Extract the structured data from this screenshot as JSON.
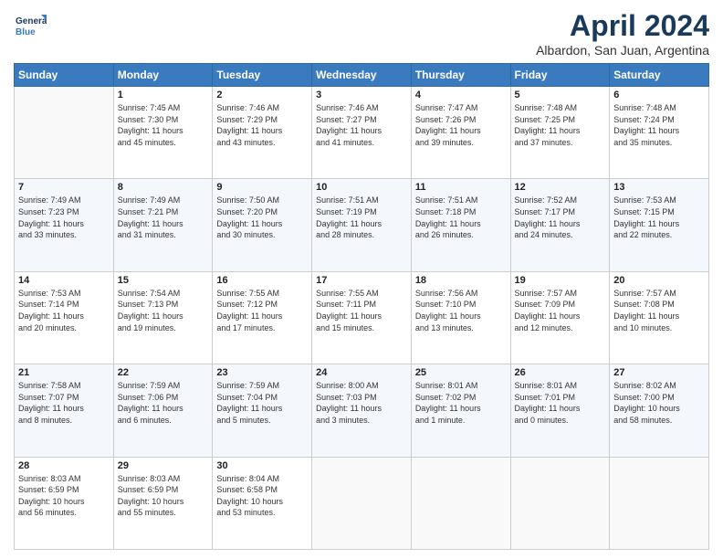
{
  "logo": {
    "line1": "General",
    "line2": "Blue"
  },
  "title": "April 2024",
  "subtitle": "Albardon, San Juan, Argentina",
  "days_header": [
    "Sunday",
    "Monday",
    "Tuesday",
    "Wednesday",
    "Thursday",
    "Friday",
    "Saturday"
  ],
  "weeks": [
    [
      {
        "num": "",
        "info": ""
      },
      {
        "num": "1",
        "info": "Sunrise: 7:45 AM\nSunset: 7:30 PM\nDaylight: 11 hours\nand 45 minutes."
      },
      {
        "num": "2",
        "info": "Sunrise: 7:46 AM\nSunset: 7:29 PM\nDaylight: 11 hours\nand 43 minutes."
      },
      {
        "num": "3",
        "info": "Sunrise: 7:46 AM\nSunset: 7:27 PM\nDaylight: 11 hours\nand 41 minutes."
      },
      {
        "num": "4",
        "info": "Sunrise: 7:47 AM\nSunset: 7:26 PM\nDaylight: 11 hours\nand 39 minutes."
      },
      {
        "num": "5",
        "info": "Sunrise: 7:48 AM\nSunset: 7:25 PM\nDaylight: 11 hours\nand 37 minutes."
      },
      {
        "num": "6",
        "info": "Sunrise: 7:48 AM\nSunset: 7:24 PM\nDaylight: 11 hours\nand 35 minutes."
      }
    ],
    [
      {
        "num": "7",
        "info": "Sunrise: 7:49 AM\nSunset: 7:23 PM\nDaylight: 11 hours\nand 33 minutes."
      },
      {
        "num": "8",
        "info": "Sunrise: 7:49 AM\nSunset: 7:21 PM\nDaylight: 11 hours\nand 31 minutes."
      },
      {
        "num": "9",
        "info": "Sunrise: 7:50 AM\nSunset: 7:20 PM\nDaylight: 11 hours\nand 30 minutes."
      },
      {
        "num": "10",
        "info": "Sunrise: 7:51 AM\nSunset: 7:19 PM\nDaylight: 11 hours\nand 28 minutes."
      },
      {
        "num": "11",
        "info": "Sunrise: 7:51 AM\nSunset: 7:18 PM\nDaylight: 11 hours\nand 26 minutes."
      },
      {
        "num": "12",
        "info": "Sunrise: 7:52 AM\nSunset: 7:17 PM\nDaylight: 11 hours\nand 24 minutes."
      },
      {
        "num": "13",
        "info": "Sunrise: 7:53 AM\nSunset: 7:15 PM\nDaylight: 11 hours\nand 22 minutes."
      }
    ],
    [
      {
        "num": "14",
        "info": "Sunrise: 7:53 AM\nSunset: 7:14 PM\nDaylight: 11 hours\nand 20 minutes."
      },
      {
        "num": "15",
        "info": "Sunrise: 7:54 AM\nSunset: 7:13 PM\nDaylight: 11 hours\nand 19 minutes."
      },
      {
        "num": "16",
        "info": "Sunrise: 7:55 AM\nSunset: 7:12 PM\nDaylight: 11 hours\nand 17 minutes."
      },
      {
        "num": "17",
        "info": "Sunrise: 7:55 AM\nSunset: 7:11 PM\nDaylight: 11 hours\nand 15 minutes."
      },
      {
        "num": "18",
        "info": "Sunrise: 7:56 AM\nSunset: 7:10 PM\nDaylight: 11 hours\nand 13 minutes."
      },
      {
        "num": "19",
        "info": "Sunrise: 7:57 AM\nSunset: 7:09 PM\nDaylight: 11 hours\nand 12 minutes."
      },
      {
        "num": "20",
        "info": "Sunrise: 7:57 AM\nSunset: 7:08 PM\nDaylight: 11 hours\nand 10 minutes."
      }
    ],
    [
      {
        "num": "21",
        "info": "Sunrise: 7:58 AM\nSunset: 7:07 PM\nDaylight: 11 hours\nand 8 minutes."
      },
      {
        "num": "22",
        "info": "Sunrise: 7:59 AM\nSunset: 7:06 PM\nDaylight: 11 hours\nand 6 minutes."
      },
      {
        "num": "23",
        "info": "Sunrise: 7:59 AM\nSunset: 7:04 PM\nDaylight: 11 hours\nand 5 minutes."
      },
      {
        "num": "24",
        "info": "Sunrise: 8:00 AM\nSunset: 7:03 PM\nDaylight: 11 hours\nand 3 minutes."
      },
      {
        "num": "25",
        "info": "Sunrise: 8:01 AM\nSunset: 7:02 PM\nDaylight: 11 hours\nand 1 minute."
      },
      {
        "num": "26",
        "info": "Sunrise: 8:01 AM\nSunset: 7:01 PM\nDaylight: 11 hours\nand 0 minutes."
      },
      {
        "num": "27",
        "info": "Sunrise: 8:02 AM\nSunset: 7:00 PM\nDaylight: 10 hours\nand 58 minutes."
      }
    ],
    [
      {
        "num": "28",
        "info": "Sunrise: 8:03 AM\nSunset: 6:59 PM\nDaylight: 10 hours\nand 56 minutes."
      },
      {
        "num": "29",
        "info": "Sunrise: 8:03 AM\nSunset: 6:59 PM\nDaylight: 10 hours\nand 55 minutes."
      },
      {
        "num": "30",
        "info": "Sunrise: 8:04 AM\nSunset: 6:58 PM\nDaylight: 10 hours\nand 53 minutes."
      },
      {
        "num": "",
        "info": ""
      },
      {
        "num": "",
        "info": ""
      },
      {
        "num": "",
        "info": ""
      },
      {
        "num": "",
        "info": ""
      }
    ]
  ]
}
